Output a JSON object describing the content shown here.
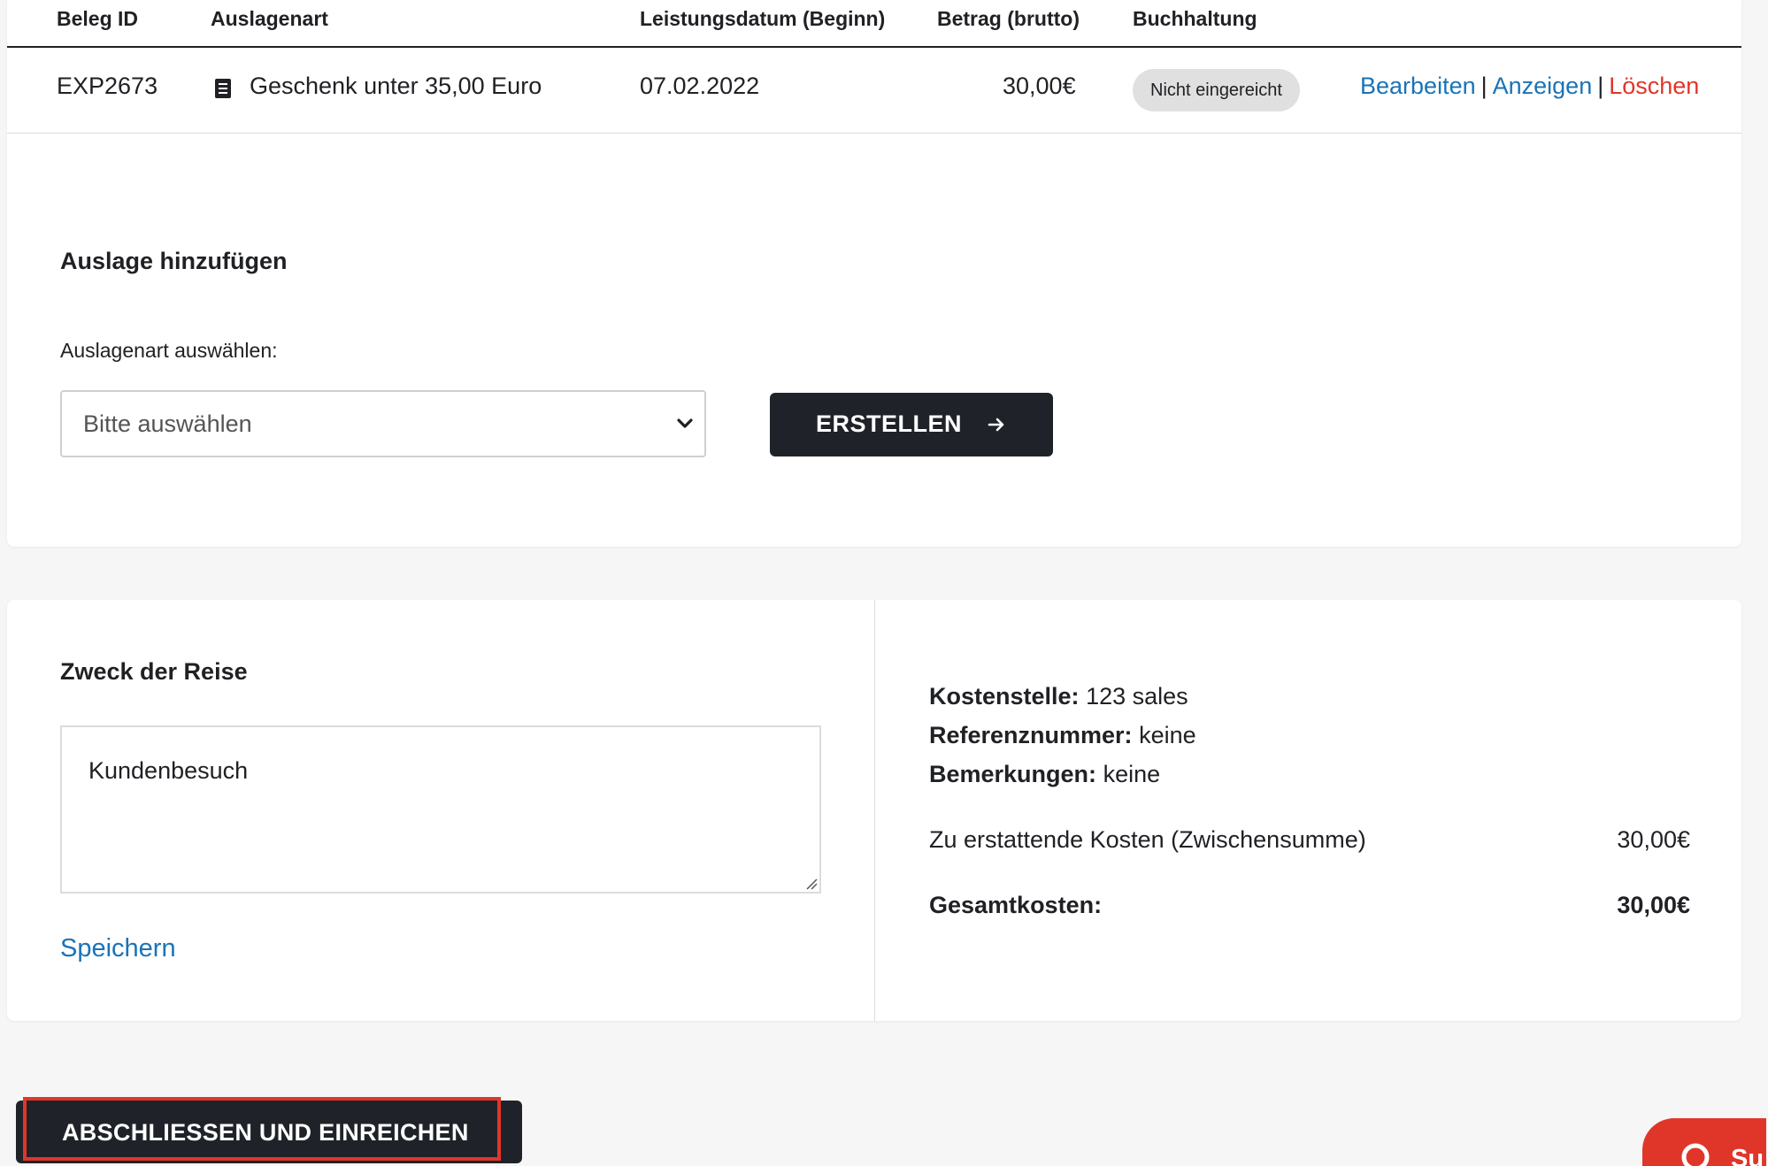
{
  "table": {
    "headers": {
      "beleg_id": "Beleg ID",
      "auslagenart": "Auslagenart",
      "leistungsdatum": "Leistungsdatum (Beginn)",
      "betrag": "Betrag (brutto)",
      "buchhaltung": "Buchhaltung"
    },
    "rows": [
      {
        "beleg_id": "EXP2673",
        "auslagenart": "Geschenk unter 35,00 Euro",
        "auslagenart_icon": "document-icon",
        "leistungsdatum": "07.02.2022",
        "betrag": "30,00€",
        "status": "Nicht eingereicht",
        "actions": {
          "edit": "Bearbeiten",
          "view": "Anzeigen",
          "delete": "Löschen",
          "separator": "|"
        }
      }
    ]
  },
  "add_expense": {
    "title": "Auslage hinzufügen",
    "select_label": "Auslagenart auswählen:",
    "select_value": "Bitte auswählen",
    "create_button": "ERSTELLEN",
    "create_icon": "arrow-right-icon"
  },
  "purpose": {
    "title": "Zweck der Reise",
    "value": "Kundenbesuch",
    "save_link": "Speichern"
  },
  "summary": {
    "cost_center_label": "Kostenstelle:",
    "cost_center_value": "123 sales",
    "reference_label": "Referenznummer:",
    "reference_value": "keine",
    "remarks_label": "Bemerkungen:",
    "remarks_value": "keine",
    "subtotal_label": "Zu erstattende Kosten (Zwischensumme)",
    "subtotal_value": "30,00€",
    "total_label": "Gesamtkosten:",
    "total_value": "30,00€"
  },
  "submit_button": "ABSCHLIESSEN UND EINREICHEN",
  "support": {
    "label": "Su",
    "icon": "chat-bubble-icon"
  },
  "colors": {
    "accent_link": "#1a73b7",
    "danger": "#e0362a",
    "button_dark": "#1f2329",
    "page_bg": "#f6f6f6",
    "badge_bg": "#e0e0e0"
  }
}
